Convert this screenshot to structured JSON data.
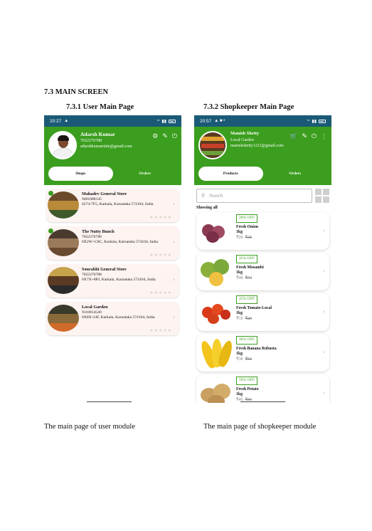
{
  "section_title": "7.3 MAIN SCREEN",
  "left": {
    "subtitle": "7.3.1 User Main Page",
    "caption": "The main page of user module",
    "status": {
      "time": "20:27",
      "right_text": "ᴸᵀᴱ",
      "network": " "
    },
    "user": {
      "name": "Adarsh Kumar",
      "phone": "7022276788",
      "email": "adarshkumarnitte@gmail.com"
    },
    "tabs": [
      "Shops",
      "Orders"
    ],
    "shops": [
      {
        "name": "Mahadev General Store",
        "phone": "9481688145",
        "address": "6274-7F5, Karkala, Karnataka 574104, India"
      },
      {
        "name": "The Nutty Bunch",
        "phone": "7022276788",
        "address": "6X2W+C8C, Karkala, Karnataka 574104, India"
      },
      {
        "name": "Sourabhi General Store",
        "phone": "7022276788",
        "address": "6X7X+8PJ, Karkala, Karnataka 574104, India"
      },
      {
        "name": "Local Garden",
        "phone": "9110814540",
        "address": "6X8X-34F, Karkala, Karnataka 574104, India"
      }
    ]
  },
  "right": {
    "subtitle": "7.3.2 Shopkeeper Main Page",
    "caption": "The main page of shopkeeper module",
    "status": {
      "time": "20:57"
    },
    "user": {
      "name": "Manish Shetty",
      "shop": "Local Garden",
      "email": "manishshetty1221@gmail.com"
    },
    "tabs": [
      "Products",
      "Orders"
    ],
    "search_placeholder": "Search",
    "showing": "Showing all",
    "products": [
      {
        "off": "28% OFF",
        "name": "Fresh Onion",
        "qty": "1kg",
        "price": "₹20",
        "mrp": "₹28",
        "color": "#8b3a52"
      },
      {
        "off": "45% OFF",
        "name": "Fresh Mosambi",
        "qty": "1kg",
        "price": "₹40",
        "mrp": "₹74",
        "color": "#7aa83a"
      },
      {
        "off": "25% OFF",
        "name": "Fresh Tomato-Local",
        "qty": "1kg",
        "price": "₹15",
        "mrp": "₹20",
        "color": "#d83a1a"
      },
      {
        "off": "40% OFF",
        "name": "Fresh Banana Robusta",
        "qty": "1kg",
        "price": "₹30",
        "mrp": "₹50",
        "color": "#f2c31a"
      },
      {
        "off": "18% OFF",
        "name": "Fresh Potato",
        "qty": "1kg",
        "price": "₹45",
        "mrp": "₹55",
        "color": "#c9a060"
      }
    ]
  }
}
